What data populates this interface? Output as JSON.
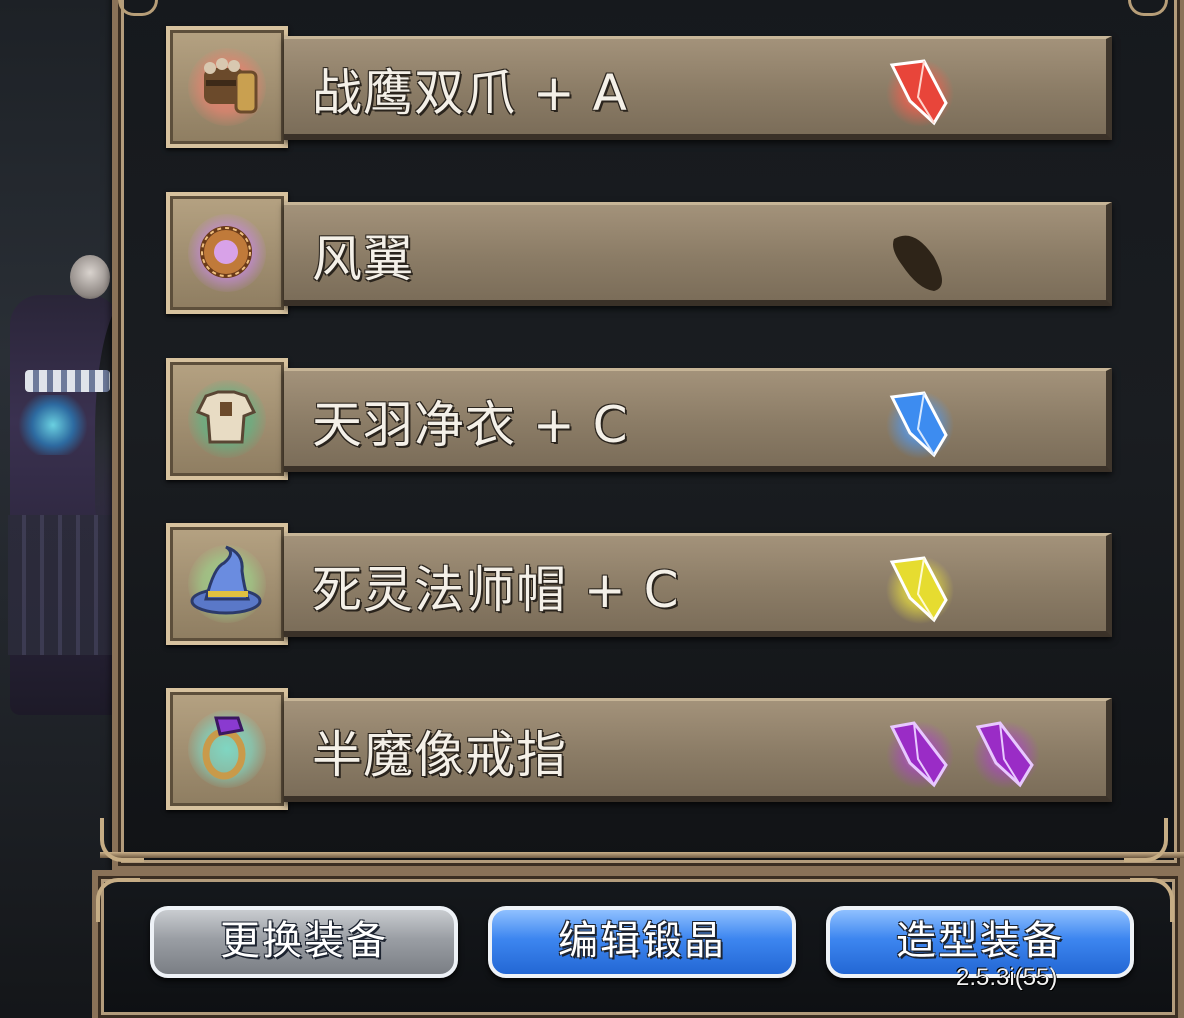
{
  "equipment": [
    {
      "name": "战鹰双爪 + A",
      "icon": "gauntlet-icon",
      "glow": "#e9826f",
      "crystals": [
        {
          "type": "crystal-icon",
          "color": "#ff5a4a"
        }
      ]
    },
    {
      "name": "风翼",
      "icon": "ring-icon",
      "glow": "#c68ae0",
      "crystals": [
        {
          "type": "empty-crystal-icon",
          "color": "#2e2418"
        }
      ]
    },
    {
      "name": "天羽净衣 + C",
      "icon": "robe-icon",
      "glow": "#5fb585",
      "crystals": [
        {
          "type": "crystal-icon",
          "color": "#4a9cff"
        }
      ]
    },
    {
      "name": "死灵法师帽 + C",
      "icon": "wizard-hat-icon",
      "glow": "#9fd08a",
      "crystals": [
        {
          "type": "crystal-icon",
          "color": "#f2e83a"
        }
      ]
    },
    {
      "name": "半魔像戒指",
      "icon": "gem-ring-icon",
      "glow": "#7fd6c2",
      "crystals": [
        {
          "type": "crystal-icon",
          "color": "#b03ad6"
        },
        {
          "type": "crystal-icon",
          "color": "#b03ad6"
        }
      ]
    }
  ],
  "buttons": {
    "change_equipment": "更换装备",
    "edit_crystals": "编辑锻晶",
    "appearance_equipment": "造型装备"
  },
  "version": "2.5.3i(55)"
}
